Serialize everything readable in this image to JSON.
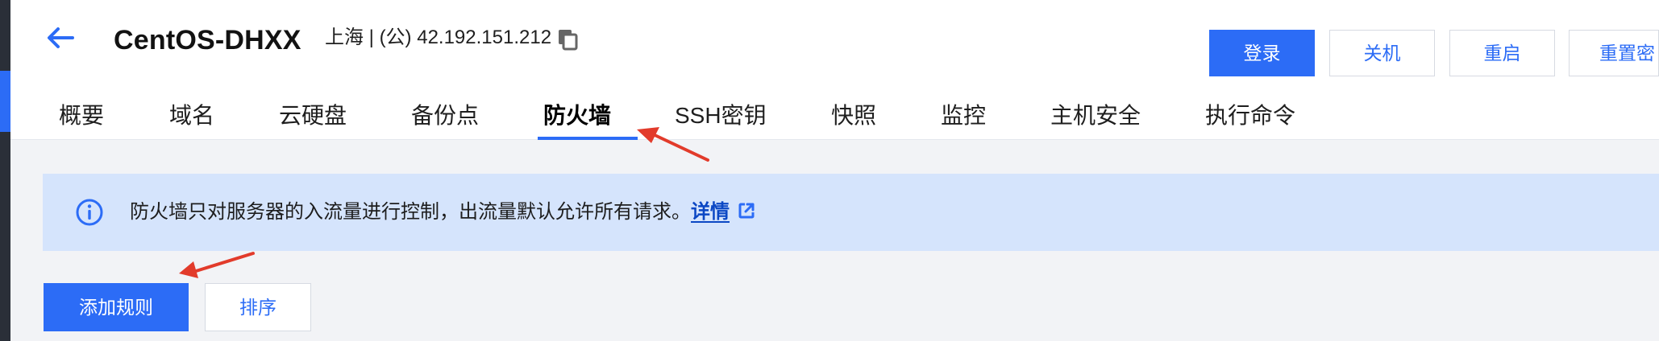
{
  "header": {
    "title": "CentOS-DHXX",
    "meta": "上海 | (公) 42.192.151.212",
    "back_icon": "arrow-left-icon",
    "copy_icon": "copy-icon"
  },
  "actions": {
    "login": "登录",
    "shutdown": "关机",
    "restart": "重启",
    "reset_password": "重置密"
  },
  "tabs": [
    {
      "label": "概要",
      "active": false
    },
    {
      "label": "域名",
      "active": false
    },
    {
      "label": "云硬盘",
      "active": false
    },
    {
      "label": "备份点",
      "active": false
    },
    {
      "label": "防火墙",
      "active": true
    },
    {
      "label": "SSH密钥",
      "active": false
    },
    {
      "label": "快照",
      "active": false
    },
    {
      "label": "监控",
      "active": false
    },
    {
      "label": "主机安全",
      "active": false
    },
    {
      "label": "执行命令",
      "active": false
    }
  ],
  "notice": {
    "icon": "info-icon",
    "text": "防火墙只对服务器的入流量进行控制，出流量默认允许所有请求。",
    "link": "详情",
    "link_icon": "external-link-icon"
  },
  "toolbar": {
    "add_rule": "添加规则",
    "sort": "排序"
  },
  "colors": {
    "primary": "#2c6cf6",
    "notice_background": "#d5e4fc",
    "annotation_arrow": "#e23b2b"
  }
}
